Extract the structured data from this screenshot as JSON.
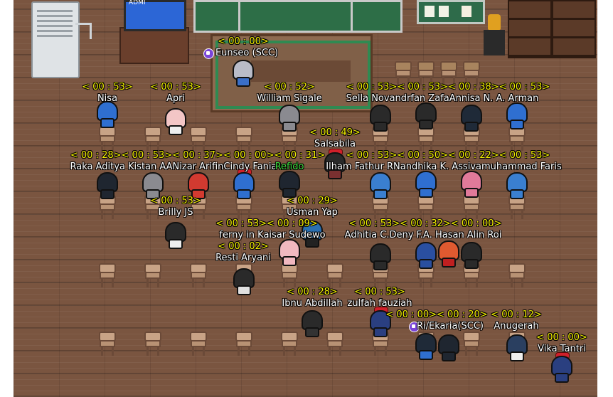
{
  "scene": {
    "tv_label": "ADMI",
    "colors": {
      "floor": "#7a5540",
      "timer": "#f4f000",
      "name": "#ffffff",
      "highlight_name": "#3fdc3f",
      "badge": "#7a44d8"
    },
    "icons": [
      "ac-unit",
      "tv",
      "chalkboard",
      "notice-board",
      "trophy",
      "bookshelf",
      "chair",
      "avatar",
      "scc-badge-icon"
    ]
  },
  "timers": [
    "< 00 : 00>",
    "< 00 : 53>",
    "< 00 : 53>",
    "< 00 : 52>",
    "< 00 : 53>< 00 : 53>< 00 : 38>< 00 : 53>",
    "< 00 : 49>",
    "< 00 : 28>< 00 : 53>< 00 : 37>< 00 : 00>< 00 : 31>",
    "< 00 : 53>< 00 : 50>< 00 : 22>< 00 : 53>",
    "< 00 : 53>",
    "< 00 : 29>",
    "< 00 : 53>< 00 : 09>",
    "< 00 : 53>< 00 : 32>< 00 : 00>",
    "< 00 : 02>",
    "< 00 : 28>",
    "< 00 : 53>",
    "< 00 : 00>< 00 : 20>",
    "< 00 : 12>",
    "< 00 : 00>"
  ],
  "names": {
    "eunseo": "Eunseo (SCC)",
    "nisa": "Nisa",
    "apri": "Apri",
    "william": "William Sigale",
    "row1_right": "Sella Novandrfan ZafaAnnisa N. A.  Arman",
    "salsabila": "Salsabila",
    "row2_left": "Raka Aditya Kistan AANizar ArifinCindy Fania",
    "refido": "Refido",
    "row2_right": "Ilham Fathur RNandhika K.  Assivamuhammad Faris",
    "brilly": "Brilly JS",
    "usman": "Usman Yap",
    "ferny": "ferny in Kaisar Sudewo",
    "row3_right": "Adhitia C.Deny F.A. Hasan Alin Roi",
    "resti": "Resti Aryani",
    "ibnu": "Ibnu Abdillah",
    "zulfah": "zulfah fauziah",
    "eka": "Ri/Ekaria(SCC)",
    "anugerah": "Anugerah",
    "vika": "Vika Tantri"
  }
}
